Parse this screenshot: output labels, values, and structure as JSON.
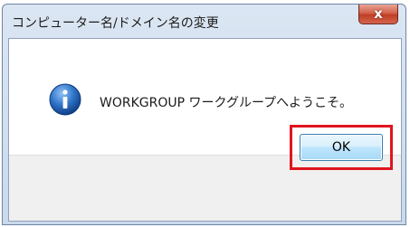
{
  "window": {
    "title": "コンピューター名/ドメイン名の変更",
    "close_glyph": "x"
  },
  "message": {
    "icon": "info-icon",
    "text": "WORKGROUP ワークグループへようこそ。"
  },
  "buttons": {
    "ok_label": "OK"
  },
  "colors": {
    "highlight": "#e0141f",
    "info_icon": "#1f5fb3"
  }
}
